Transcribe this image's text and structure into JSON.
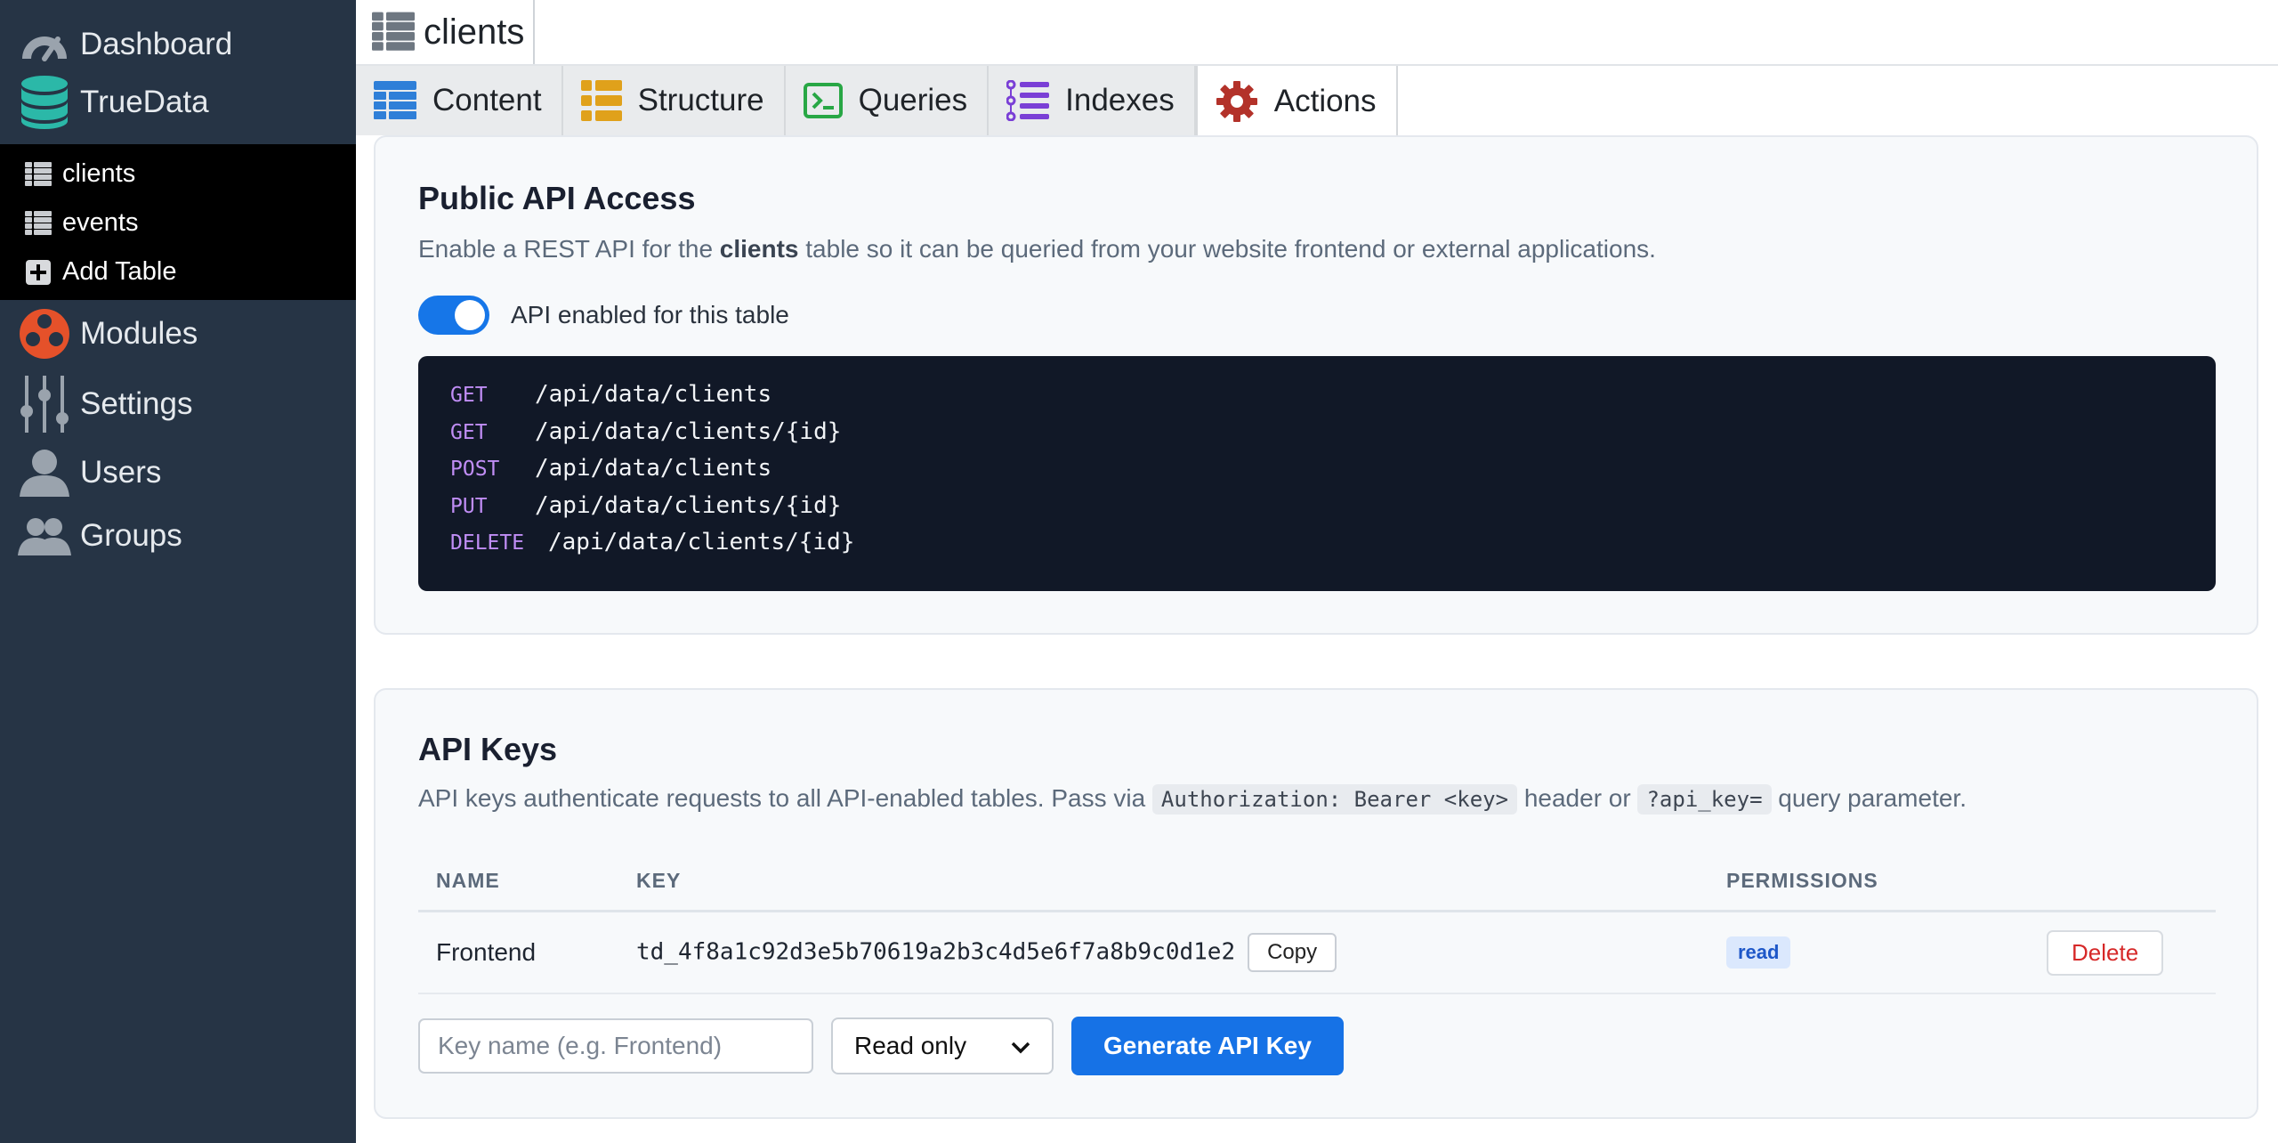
{
  "sidebar": {
    "dashboard": "Dashboard",
    "database": "TrueData",
    "tables": [
      {
        "label": "clients"
      },
      {
        "label": "events"
      }
    ],
    "add_table": "Add Table",
    "modules": "Modules",
    "settings": "Settings",
    "users": "Users",
    "groups": "Groups"
  },
  "header": {
    "title": "clients"
  },
  "tabs": [
    {
      "label": "Content",
      "icon": "grid-icon",
      "color": "#2f7fd8"
    },
    {
      "label": "Structure",
      "icon": "structure-icon",
      "color": "#e0a11b"
    },
    {
      "label": "Queries",
      "icon": "terminal-icon",
      "color": "#28a745"
    },
    {
      "label": "Indexes",
      "icon": "list-icon",
      "color": "#7a3fd6"
    },
    {
      "label": "Actions",
      "icon": "gear-icon",
      "color": "#b3322a",
      "active": true
    }
  ],
  "public_api": {
    "title": "Public API Access",
    "desc_before": "Enable a REST API for the ",
    "desc_bold": "clients",
    "desc_after": " table so it can be queried from your website frontend or external applications.",
    "toggle_label": "API enabled for this table",
    "toggle_on": true,
    "endpoints": [
      {
        "method": "GET",
        "path": "/api/data/clients"
      },
      {
        "method": "GET",
        "path": "/api/data/clients/{id}"
      },
      {
        "method": "POST",
        "path": "/api/data/clients"
      },
      {
        "method": "PUT",
        "path": "/api/data/clients/{id}"
      },
      {
        "method": "DELETE",
        "path": "/api/data/clients/{id}"
      }
    ]
  },
  "api_keys": {
    "title": "API Keys",
    "desc_1": "API keys authenticate requests to all API-enabled tables. Pass via ",
    "code_1": "Authorization: Bearer <key>",
    "desc_2": " header or ",
    "code_2": "?api_key=",
    "desc_3": " query parameter.",
    "columns": {
      "name": "NAME",
      "key": "KEY",
      "permissions": "PERMISSIONS"
    },
    "rows": [
      {
        "name": "Frontend",
        "key": "td_4f8a1c92d3e5b70619a2b3c4d5e6f7a8b9c0d1e2",
        "copy": "Copy",
        "permission": "read",
        "delete": "Delete"
      }
    ],
    "form": {
      "placeholder": "Key name (e.g. Frontend)",
      "select_value": "Read only",
      "generate": "Generate API Key"
    }
  },
  "colors": {
    "sidebar_bg": "#263445",
    "accent_blue": "#1672e6",
    "code_bg": "#111827",
    "method_purple": "#c08df5",
    "danger": "#d62828"
  }
}
